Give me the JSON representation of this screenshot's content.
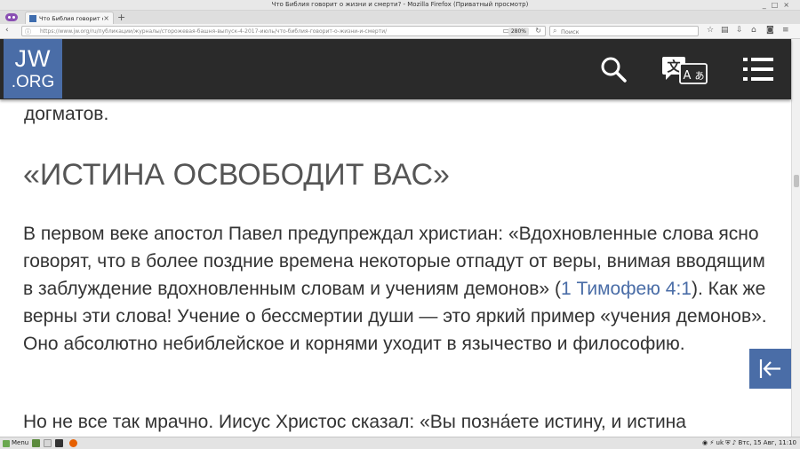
{
  "window": {
    "title": "Что Библия говорит о жизни и смерти? - Mozilla Firefox (Приватный просмотр)",
    "controls": [
      "_",
      "□",
      "×"
    ]
  },
  "tab": {
    "label": "Что Библия говорит о жи",
    "close": "×",
    "new_tab": "+"
  },
  "navbar": {
    "back": "‹",
    "url": "https://www.jw.org/ru/публикации/журналы/сторожевая-башня-выпуск-4-2017-июль/что-библия-говорит-о-жизни-и-смерти/",
    "zoom": "280%",
    "search_placeholder": "Поиск"
  },
  "site": {
    "logo_line1": "JW",
    "logo_line2": ".ORG",
    "icons": [
      "search-icon",
      "language-icon",
      "menu-icon"
    ]
  },
  "article": {
    "fragment": "догматов.",
    "heading": "«ИСТИНА ОСВОБОДИТ ВАС»",
    "p1_before": "В первом веке апостол Павел предупреждал христиан: «Вдохновленные слова ясно говорят, что в более поздние времена некоторые отпадут от веры, внимая вводящим в заблуждение вдохновленным словам и учениям демонов» (",
    "p1_link": "1 Тимофею 4:1",
    "p1_after": "). Как же верны эти слова! Учение о бессмертии души — это яркий пример «учения демонов». Оно абсолютно небиблейское и корнями уходит в язычество и философию.",
    "p2": "Но не все так мрачно. Иисус Христос сказал: «Вы позна́ете истину, и истина"
  },
  "taskbar": {
    "menu": "Menu",
    "keyboard": "uk",
    "datetime": "Втс, 15 Авг, 11:10"
  },
  "colors": {
    "header_bg": "#2a2a2a",
    "brand_blue": "#4a6da7",
    "text": "#333333",
    "heading": "#555555"
  }
}
